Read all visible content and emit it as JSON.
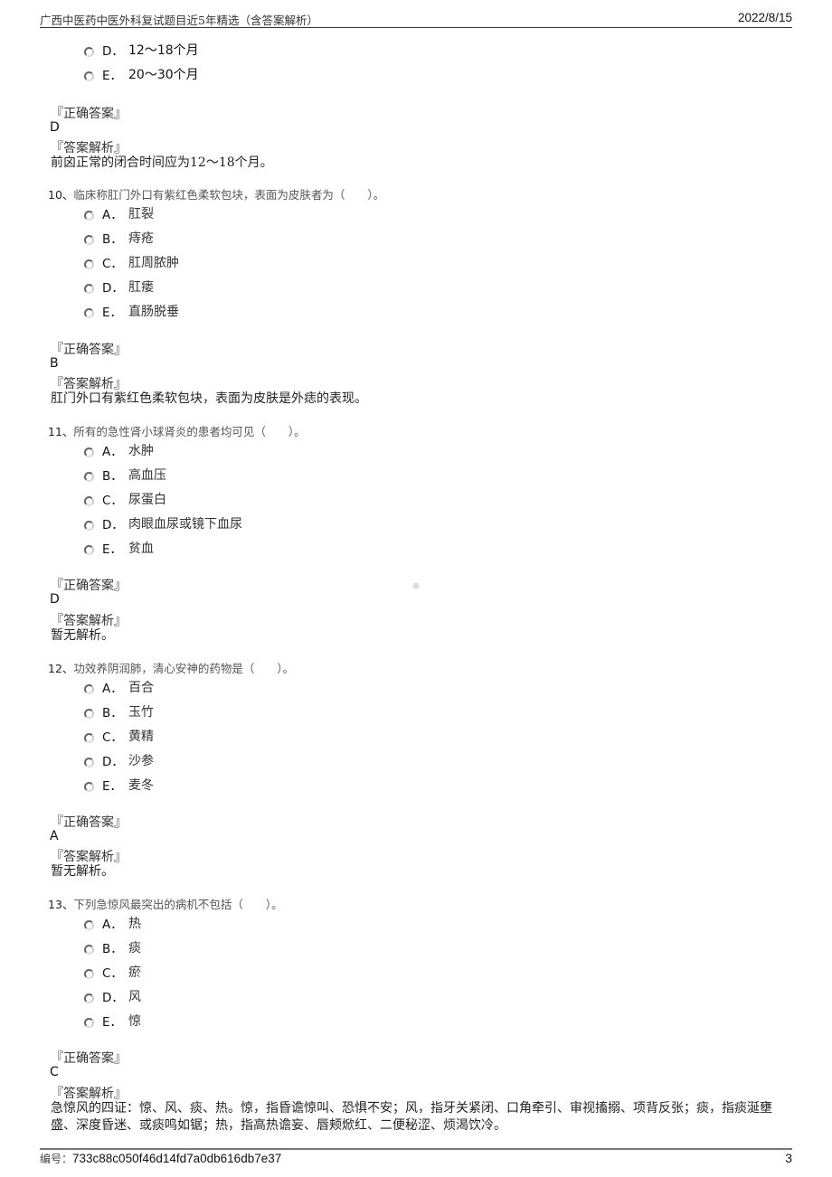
{
  "header": {
    "title": "广西中医药中医外科复试题目近5年精选（含答案解析）",
    "date": "2022/8/15"
  },
  "footer": {
    "code_label": "编号：",
    "code_value": "733c88c050f46d14fd7a0db616db7e37",
    "page": "3"
  },
  "labels": {
    "correct_answer": "『正确答案』",
    "analysis": "『答案解析』"
  },
  "prev": {
    "options": [
      {
        "letter": "D．",
        "text": "12～18个月"
      },
      {
        "letter": "E．",
        "text": "20～30个月"
      }
    ],
    "answer": "D",
    "analysis": "前囟正常的闭合时间应为12～18个月。"
  },
  "questions": [
    {
      "number": "10、",
      "stem": "临床称肛门外口有紫红色柔软包块，表面为皮肤者为（　　）。",
      "options": [
        {
          "letter": "A．",
          "text": "肛裂"
        },
        {
          "letter": "B．",
          "text": "痔疮"
        },
        {
          "letter": "C．",
          "text": "肛周脓肿"
        },
        {
          "letter": "D．",
          "text": "肛瘘"
        },
        {
          "letter": "E．",
          "text": "直肠脱垂"
        }
      ],
      "answer": "B",
      "analysis": "肛门外口有紫红色柔软包块，表面为皮肤是外痣的表现。"
    },
    {
      "number": "11、",
      "stem": "所有的急性肾小球肾炎的患者均可见（　　）。",
      "options": [
        {
          "letter": "A．",
          "text": "水肿"
        },
        {
          "letter": "B．",
          "text": "高血压"
        },
        {
          "letter": "C．",
          "text": "尿蛋白"
        },
        {
          "letter": "D．",
          "text": "肉眼血尿或镜下血尿"
        },
        {
          "letter": "E．",
          "text": "贫血"
        }
      ],
      "answer": "D",
      "analysis": "暂无解析。"
    },
    {
      "number": "12、",
      "stem": "功效养阴润肺，清心安神的药物是（　　）。",
      "options": [
        {
          "letter": "A．",
          "text": "百合"
        },
        {
          "letter": "B．",
          "text": "玉竹"
        },
        {
          "letter": "C．",
          "text": "黄精"
        },
        {
          "letter": "D．",
          "text": "沙参"
        },
        {
          "letter": "E．",
          "text": "麦冬"
        }
      ],
      "answer": "A",
      "analysis": "暂无解析。"
    },
    {
      "number": "13、",
      "stem": "下列急惊风最突出的病机不包括（　　）。",
      "options": [
        {
          "letter": "A．",
          "text": "热"
        },
        {
          "letter": "B．",
          "text": "痰"
        },
        {
          "letter": "C．",
          "text": "瘀"
        },
        {
          "letter": "D．",
          "text": "风"
        },
        {
          "letter": "E．",
          "text": "惊"
        }
      ],
      "answer": "C",
      "analysis": "急惊风的四证：惊、风、痰、热。惊，指昏谵惊叫、恐惧不安；风，指牙关紧闭、口角牵引、审视搐搦、项背反张；痰，指痰涎壅盛、深度昏迷、或痰鸣如锯；热，指高热谵妄、唇颊焮红、二便秘涩、烦渴饮冷。"
    }
  ]
}
